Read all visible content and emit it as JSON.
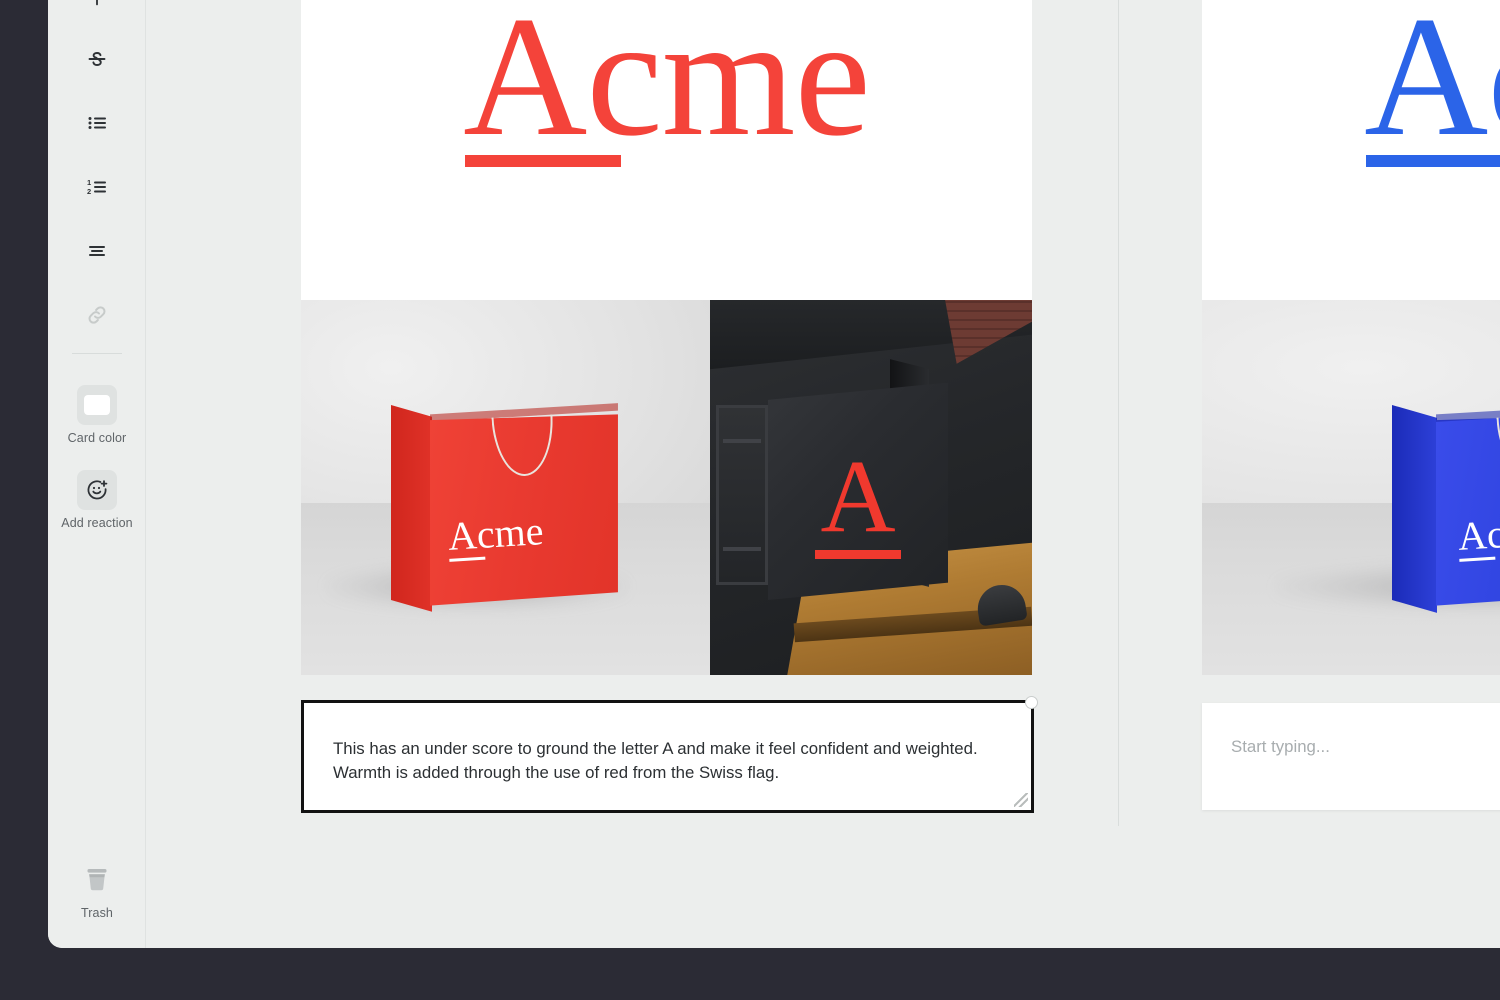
{
  "theme": {
    "app_background": "#2b2b35",
    "panel_background": "#eceeed",
    "card_background": "#ffffff",
    "brand_red": "#f4433a",
    "brand_blue": "#2b64e8",
    "selected_border": "#121212",
    "muted_text": "#5f6468",
    "placeholder_text": "#a8adaf"
  },
  "toolbar": {
    "items": [
      {
        "icon": "strikethrough-icon",
        "name": "strikethrough-button",
        "label": ""
      },
      {
        "icon": "bulleted-list-icon",
        "name": "bulleted-list-button",
        "label": ""
      },
      {
        "icon": "numbered-list-icon",
        "name": "numbered-list-button",
        "label": ""
      },
      {
        "icon": "align-text-icon",
        "name": "align-text-button",
        "label": ""
      },
      {
        "icon": "link-icon",
        "name": "link-button",
        "label": ""
      }
    ],
    "card_color": {
      "label": "Card color",
      "swatch": "#ffffff"
    },
    "add_reaction": {
      "label": "Add reaction"
    },
    "trash": {
      "label": "Trash"
    }
  },
  "cards": [
    {
      "id": "card-red",
      "logo": {
        "text": "Acme",
        "color": "#f4433a",
        "has_underscore": true
      },
      "media": [
        {
          "name": "red-shopping-bag-photo",
          "kind": "studio-bag",
          "bag_color": "#e8392f",
          "bag_side_color": "#d62b22",
          "wordmark": "Acme",
          "wordmark_color": "#ffffff"
        },
        {
          "name": "storefront-sign-photo",
          "kind": "storefront-sign",
          "letter": "A",
          "letter_color": "#f0392e"
        }
      ],
      "composer": {
        "name": "card-note-textarea",
        "value": "This has an under score to ground the letter A and make it feel confident and weighted. Warmth is added through the use of red from the Swiss flag.",
        "placeholder": "Start typing...",
        "selected": true
      }
    },
    {
      "id": "card-blue",
      "logo": {
        "text": "Acme",
        "color": "#2b64e8",
        "has_underscore": true
      },
      "media": [
        {
          "name": "blue-shopping-bag-photo",
          "kind": "studio-bag",
          "bag_color": "#2f44e0",
          "bag_side_color": "#2033c4",
          "wordmark": "Acme",
          "wordmark_color": "#ffffff"
        }
      ],
      "composer": {
        "name": "card-note-textarea",
        "value": "",
        "placeholder": "Start typing...",
        "selected": false
      }
    }
  ]
}
